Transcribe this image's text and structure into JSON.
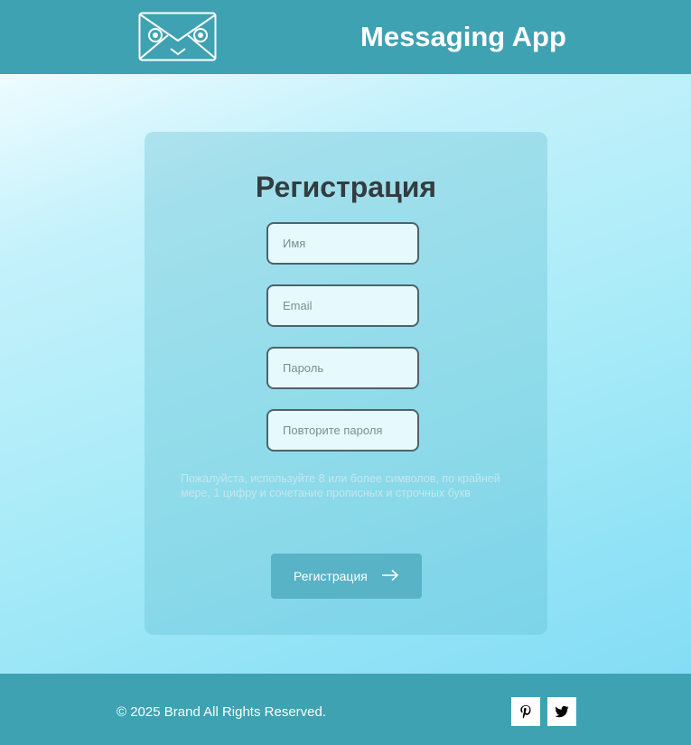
{
  "header": {
    "logo": "envelope-face-logo",
    "title": "Messaging App"
  },
  "form": {
    "title": "Регистрация",
    "fields": [
      {
        "placeholder": "Имя",
        "value": ""
      },
      {
        "placeholder": "Email",
        "value": ""
      },
      {
        "placeholder": "Пароль",
        "value": ""
      },
      {
        "placeholder": "Повторите пароля",
        "value": ""
      }
    ],
    "hint": "Пожалуйста, используйте 8 или более символов, по крайней мере, 1 цифру и сочетание прописных и строчных букв",
    "submit_label": "Регистрация",
    "submit_icon": "arrow-right-icon"
  },
  "footer": {
    "copyright": "© 2025 Brand All Rights Reserved.",
    "social": [
      {
        "icon": "pinterest-icon"
      },
      {
        "icon": "twitter-icon"
      }
    ]
  },
  "colors": {
    "header_bg": "#3ea2b2",
    "footer_bg": "#3ea2b2",
    "button_bg": "#57b3c5",
    "title_text": "#333d40"
  }
}
